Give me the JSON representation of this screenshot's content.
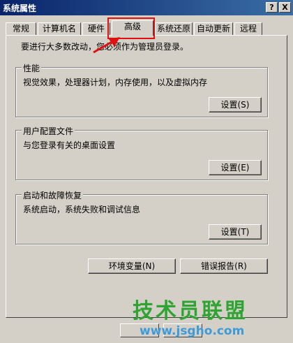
{
  "window": {
    "title": "系统属性",
    "help_btn": "?",
    "close_btn": "X"
  },
  "tabs": [
    {
      "label": "常规"
    },
    {
      "label": "计算机名"
    },
    {
      "label": "硬件"
    },
    {
      "label": "高级"
    },
    {
      "label": "系统还原"
    },
    {
      "label": "自动更新"
    },
    {
      "label": "远程"
    }
  ],
  "notice": "要进行大多数改动，您必须作为管理员登录。",
  "groups": {
    "performance": {
      "title": "性能",
      "desc": "视觉效果，处理器计划，内存使用，以及虚拟内存",
      "button": "设置(S)"
    },
    "profiles": {
      "title": "用户配置文件",
      "desc": "与您登录有关的桌面设置",
      "button": "设置(E)"
    },
    "startup": {
      "title": "启动和故障恢复",
      "desc": "系统启动，系统失败和调试信息",
      "button": "设置(T)"
    }
  },
  "buttons": {
    "env": "环境变量(N)",
    "error": "错误报告(R)"
  },
  "watermark": {
    "title": "技术员联盟",
    "url": "www.jsgho.com"
  },
  "colors": {
    "highlight": "#e01010",
    "arrow": "#e01010"
  }
}
